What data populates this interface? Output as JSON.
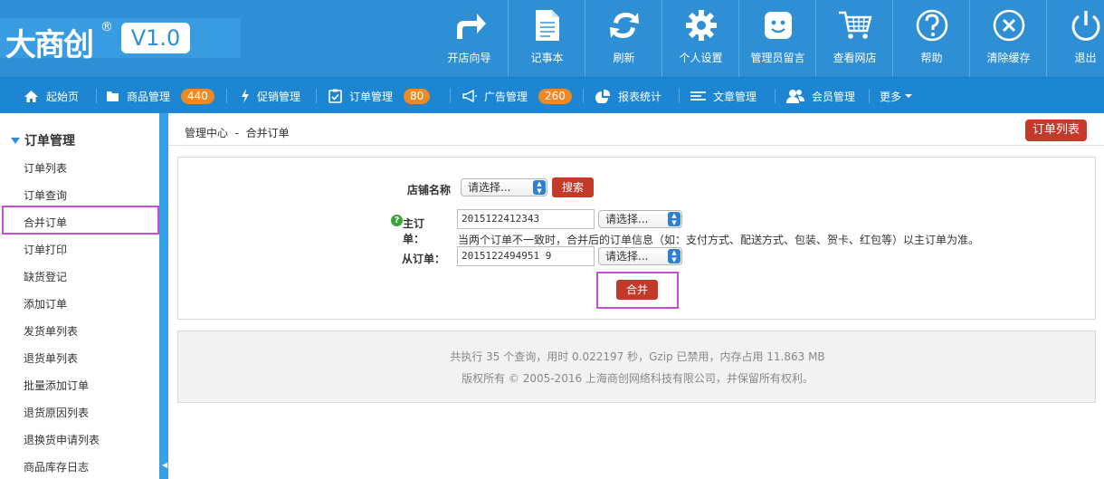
{
  "header": {
    "logo_text": "大商创",
    "logo_reg": "®",
    "version": "V1.0",
    "tools": [
      {
        "label": "开店向导",
        "icon": "share-arrow-icon"
      },
      {
        "label": "记事本",
        "icon": "notepad-icon"
      },
      {
        "label": "刷新",
        "icon": "refresh-icon"
      },
      {
        "label": "个人设置",
        "icon": "gear-icon"
      },
      {
        "label": "管理员留言",
        "icon": "message-face-icon"
      },
      {
        "label": "查看网店",
        "icon": "cart-icon"
      },
      {
        "label": "帮助",
        "icon": "help-icon"
      },
      {
        "label": "清除缓存",
        "icon": "clear-cache-icon"
      },
      {
        "label": "退出",
        "icon": "power-icon"
      }
    ]
  },
  "nav": {
    "items": [
      {
        "label": "起始页",
        "icon": "home-icon"
      },
      {
        "label": "商品管理",
        "icon": "folder-icon",
        "badge": "440"
      },
      {
        "label": "促销管理",
        "icon": "lightning-icon"
      },
      {
        "label": "订单管理",
        "icon": "clipboard-icon",
        "badge": "80"
      },
      {
        "label": "广告管理",
        "icon": "megaphone-icon",
        "badge": "260"
      },
      {
        "label": "报表统计",
        "icon": "pie-chart-icon"
      },
      {
        "label": "文章管理",
        "icon": "list-icon"
      },
      {
        "label": "会员管理",
        "icon": "users-icon"
      },
      {
        "label": "更多",
        "icon": "caret-down-icon"
      }
    ]
  },
  "sidebar": {
    "section_title": "订单管理",
    "items": [
      {
        "label": "订单列表"
      },
      {
        "label": "订单查询"
      },
      {
        "label": "合并订单"
      },
      {
        "label": "订单打印"
      },
      {
        "label": "缺货登记"
      },
      {
        "label": "添加订单"
      },
      {
        "label": "发货单列表"
      },
      {
        "label": "退货单列表"
      },
      {
        "label": "批量添加订单"
      },
      {
        "label": "退货原因列表"
      },
      {
        "label": "退换货申请列表"
      },
      {
        "label": "商品库存日志"
      }
    ],
    "active_index": 2
  },
  "main": {
    "breadcrumb": "管理中心  -  合并订单",
    "order_list_button": "订单列表",
    "form": {
      "store_label": "店铺名称",
      "store_select": "请选择...",
      "search_button": "搜索",
      "main_order_label": "主订单：",
      "main_order_value": "2015122412343",
      "main_order_select": "请选择...",
      "hint": "当两个订单不一致时，合并后的订单信息（如：支付方式、配送方式、包装、贺卡、红包等）以主订单为准。",
      "sub_order_label": "从订单：",
      "sub_order_value": "2015122494951 9",
      "sub_order_select": "请选择...",
      "merge_button": "合并"
    },
    "footer": {
      "line1": "共执行 35 个查询，用时 0.022197 秒，Gzip 已禁用，内存占用 11.863 MB",
      "line2": "版权所有 © 2005-2016 上海商创网络科技有限公司，并保留所有权利。"
    }
  },
  "colors": {
    "header_blue": "#2e8fd4",
    "nav_blue": "#1d86d3",
    "badge_orange": "#ee8a25",
    "button_red": "#c33a2a",
    "highlight_purple": "#c64fd6",
    "help_green": "#3aa339"
  }
}
